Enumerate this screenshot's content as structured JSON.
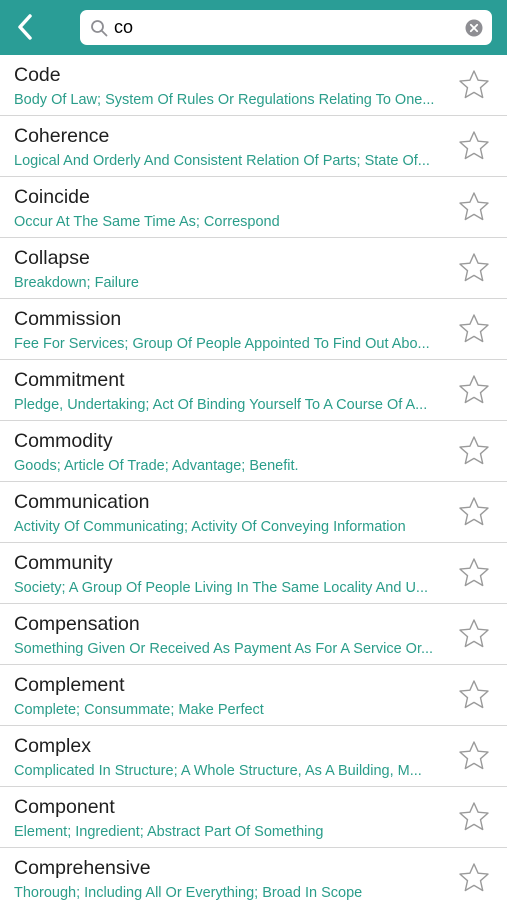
{
  "header": {
    "back_icon": "chevron-left-icon",
    "search": {
      "value": "co",
      "placeholder": "",
      "search_icon": "magnifier-icon",
      "clear_icon": "clear-circle-icon"
    }
  },
  "colors": {
    "accent": "#2a9d96",
    "meaning_text": "#2a9d8a",
    "star_outline": "#9a9a9a"
  },
  "words": [
    {
      "word": "Code",
      "meaning": "Body Of Law; System Of Rules Or Regulations Relating To One..."
    },
    {
      "word": "Coherence",
      "meaning": "Logical And Orderly And Consistent Relation Of Parts; State Of..."
    },
    {
      "word": "Coincide",
      "meaning": "Occur At The Same Time As; Correspond"
    },
    {
      "word": "Collapse",
      "meaning": "Breakdown; Failure"
    },
    {
      "word": "Commission",
      "meaning": "Fee For Services; Group Of People Appointed To Find Out Abo..."
    },
    {
      "word": "Commitment",
      "meaning": "Pledge, Undertaking; Act Of Binding Yourself To A Course Of A..."
    },
    {
      "word": "Commodity",
      "meaning": "Goods; Article Of Trade; Advantage; Benefit."
    },
    {
      "word": "Communication",
      "meaning": "Activity Of Communicating; Activity Of Conveying Information"
    },
    {
      "word": "Community",
      "meaning": "Society; A Group Of People Living In The Same Locality And U..."
    },
    {
      "word": "Compensation",
      "meaning": "Something Given Or Received As Payment As For A Service Or..."
    },
    {
      "word": "Complement",
      "meaning": "Complete; Consummate; Make Perfect"
    },
    {
      "word": "Complex",
      "meaning": "Complicated In Structure; A Whole Structure, As A Building, M..."
    },
    {
      "word": "Component",
      "meaning": "Element; Ingredient; Abstract Part Of Something"
    },
    {
      "word": "Comprehensive",
      "meaning": "Thorough; Including All Or Everything; Broad In Scope"
    }
  ]
}
